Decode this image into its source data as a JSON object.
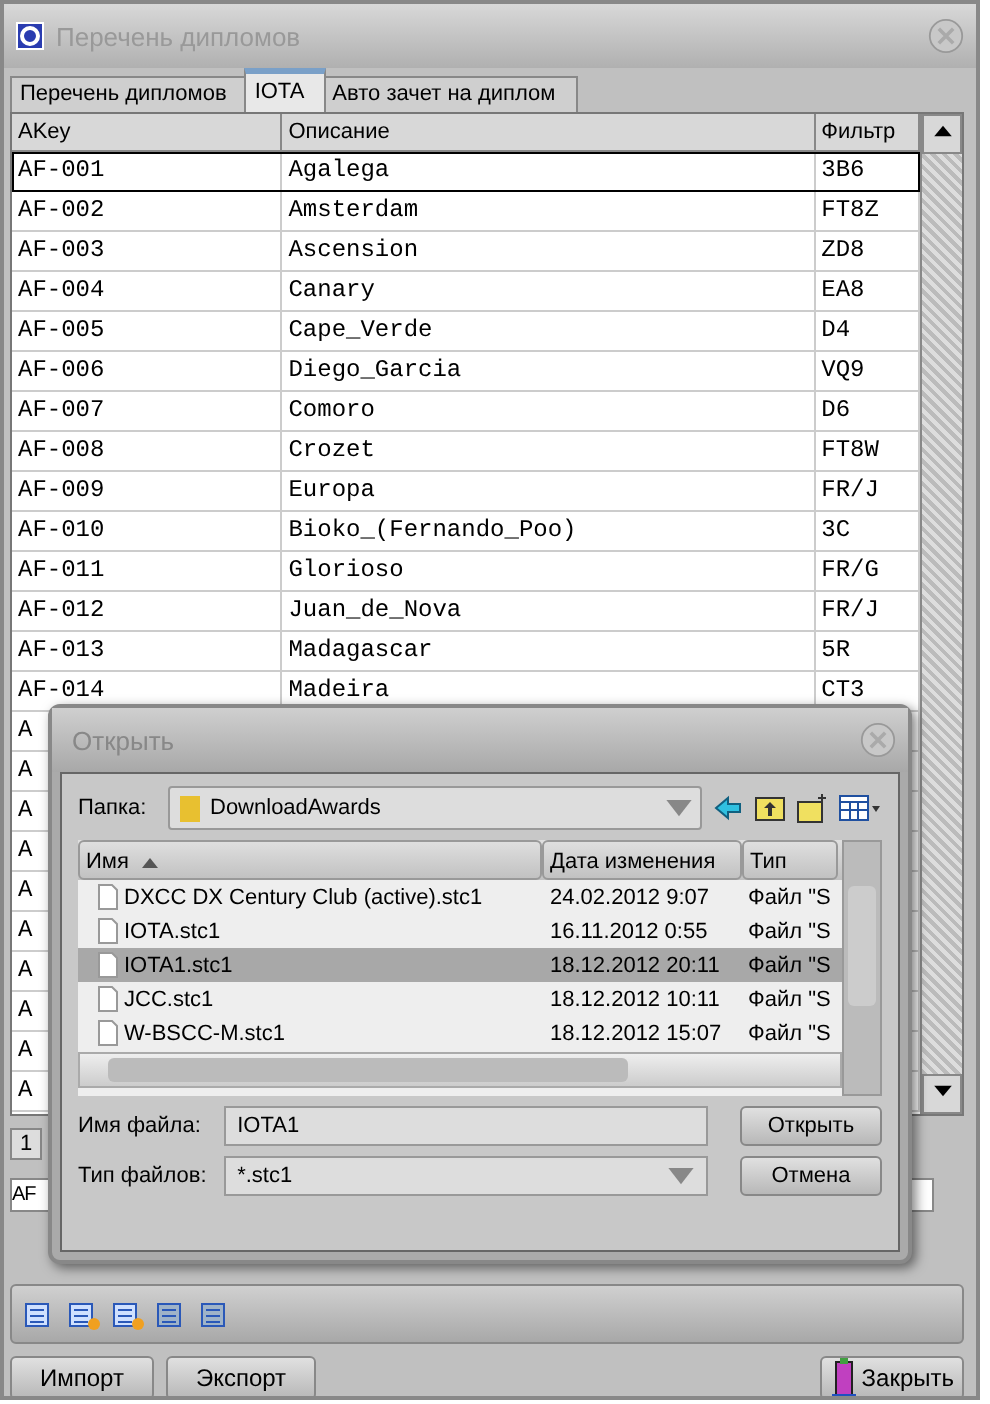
{
  "window": {
    "title": "Перечень дипломов"
  },
  "tabs": [
    {
      "label": "Перечень дипломов",
      "selected": false
    },
    {
      "label": "IOTA",
      "selected": true
    },
    {
      "label": "Авто зачет на диплом",
      "selected": false
    }
  ],
  "table": {
    "columns": [
      "AKey",
      "Описание",
      "Фильтр"
    ],
    "rows": [
      {
        "key": "AF-001",
        "desc": "Agalega",
        "filter": "3B6",
        "selected": true
      },
      {
        "key": "AF-002",
        "desc": "Amsterdam",
        "filter": "FT8Z",
        "selected": false
      },
      {
        "key": "AF-003",
        "desc": "Ascension",
        "filter": "ZD8",
        "selected": false
      },
      {
        "key": "AF-004",
        "desc": "Canary",
        "filter": "EA8",
        "selected": false
      },
      {
        "key": "AF-005",
        "desc": "Cape_Verde",
        "filter": "D4",
        "selected": false
      },
      {
        "key": "AF-006",
        "desc": "Diego_Garcia",
        "filter": "VQ9",
        "selected": false
      },
      {
        "key": "AF-007",
        "desc": "Comoro",
        "filter": "D6",
        "selected": false
      },
      {
        "key": "AF-008",
        "desc": "Crozet",
        "filter": "FT8W",
        "selected": false
      },
      {
        "key": "AF-009",
        "desc": "Europa",
        "filter": "FR/J",
        "selected": false
      },
      {
        "key": "AF-010",
        "desc": "Bioko_(Fernando_Poo)",
        "filter": "3C",
        "selected": false
      },
      {
        "key": "AF-011",
        "desc": "Glorioso",
        "filter": "FR/G",
        "selected": false
      },
      {
        "key": "AF-012",
        "desc": "Juan_de_Nova",
        "filter": "FR/J",
        "selected": false
      },
      {
        "key": "AF-013",
        "desc": "Madagascar",
        "filter": "5R",
        "selected": false
      },
      {
        "key": "AF-014",
        "desc": "Madeira",
        "filter": "CT3",
        "selected": false
      },
      {
        "key": "A",
        "desc": "",
        "filter": "",
        "selected": false
      },
      {
        "key": "A",
        "desc": "",
        "filter": "",
        "selected": false
      },
      {
        "key": "A",
        "desc": "",
        "filter": "",
        "selected": false
      },
      {
        "key": "A",
        "desc": "",
        "filter": "",
        "selected": false
      },
      {
        "key": "A",
        "desc": "",
        "filter": "",
        "selected": false
      },
      {
        "key": "A",
        "desc": "",
        "filter": "",
        "selected": false
      },
      {
        "key": "A",
        "desc": "",
        "filter": "",
        "selected": false
      },
      {
        "key": "A",
        "desc": "",
        "filter": "",
        "selected": false
      },
      {
        "key": "A",
        "desc": "",
        "filter": "",
        "selected": false
      },
      {
        "key": "A",
        "desc": "",
        "filter": "",
        "selected": false
      }
    ]
  },
  "record_number": "1",
  "edit_value": "AF",
  "buttons": {
    "import": "Импорт",
    "export": "Экспорт",
    "close": "Закрыть"
  },
  "dialog": {
    "title": "Открыть",
    "folder_label": "Папка:",
    "folder": "DownloadAwards",
    "columns": [
      "Имя",
      "Дата изменения",
      "Тип"
    ],
    "files": [
      {
        "name": "DXCC DX Century Club (active).stc1",
        "date": "24.02.2012 9:07",
        "type": "Файл \"S",
        "selected": false
      },
      {
        "name": "IOTA.stc1",
        "date": "16.11.2012 0:55",
        "type": "Файл \"S",
        "selected": false
      },
      {
        "name": "IOTA1.stc1",
        "date": "18.12.2012 20:11",
        "type": "Файл \"S",
        "selected": true
      },
      {
        "name": "JCC.stc1",
        "date": "18.12.2012 10:11",
        "type": "Файл \"S",
        "selected": false
      },
      {
        "name": "W-BSCC-M.stc1",
        "date": "18.12.2012 15:07",
        "type": "Файл \"S",
        "selected": false
      }
    ],
    "filename_label": "Имя файла:",
    "filename": "IOTA1",
    "filetype_label": "Тип файлов:",
    "filetype": "*.stc1",
    "open_button": "Открыть",
    "cancel_button": "Отмена"
  }
}
